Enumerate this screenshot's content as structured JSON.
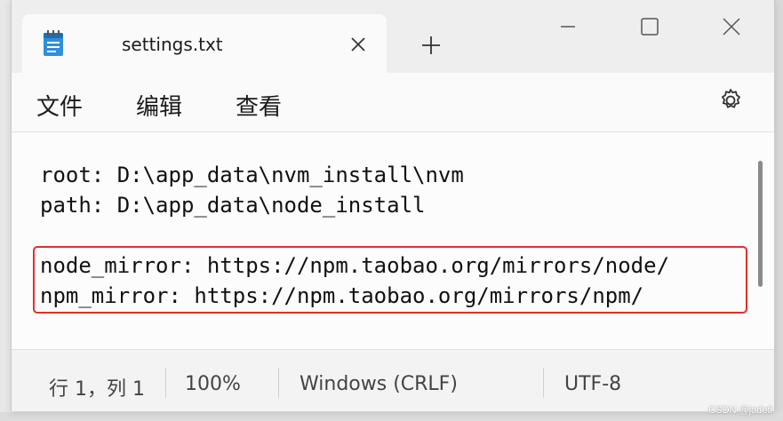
{
  "tab": {
    "title": "settings.txt",
    "icon": "notepad-icon"
  },
  "menu": {
    "file": "文件",
    "edit": "编辑",
    "view": "查看"
  },
  "editor": {
    "lines": [
      "root: D:\\app_data\\nvm_install\\nvm",
      "path: D:\\app_data\\node_install",
      "",
      "node_mirror: https://npm.taobao.org/mirrors/node/",
      "npm_mirror: https://npm.taobao.org/mirrors/npm/"
    ]
  },
  "status": {
    "position": "行 1，列 1",
    "zoom": "100%",
    "line_ending": "Windows (CRLF)",
    "encoding": "UTF-8"
  },
  "watermark": "CSDN @jadeti",
  "colors": {
    "highlight": "#e0302f",
    "icon_blue": "#2f8fd8"
  }
}
